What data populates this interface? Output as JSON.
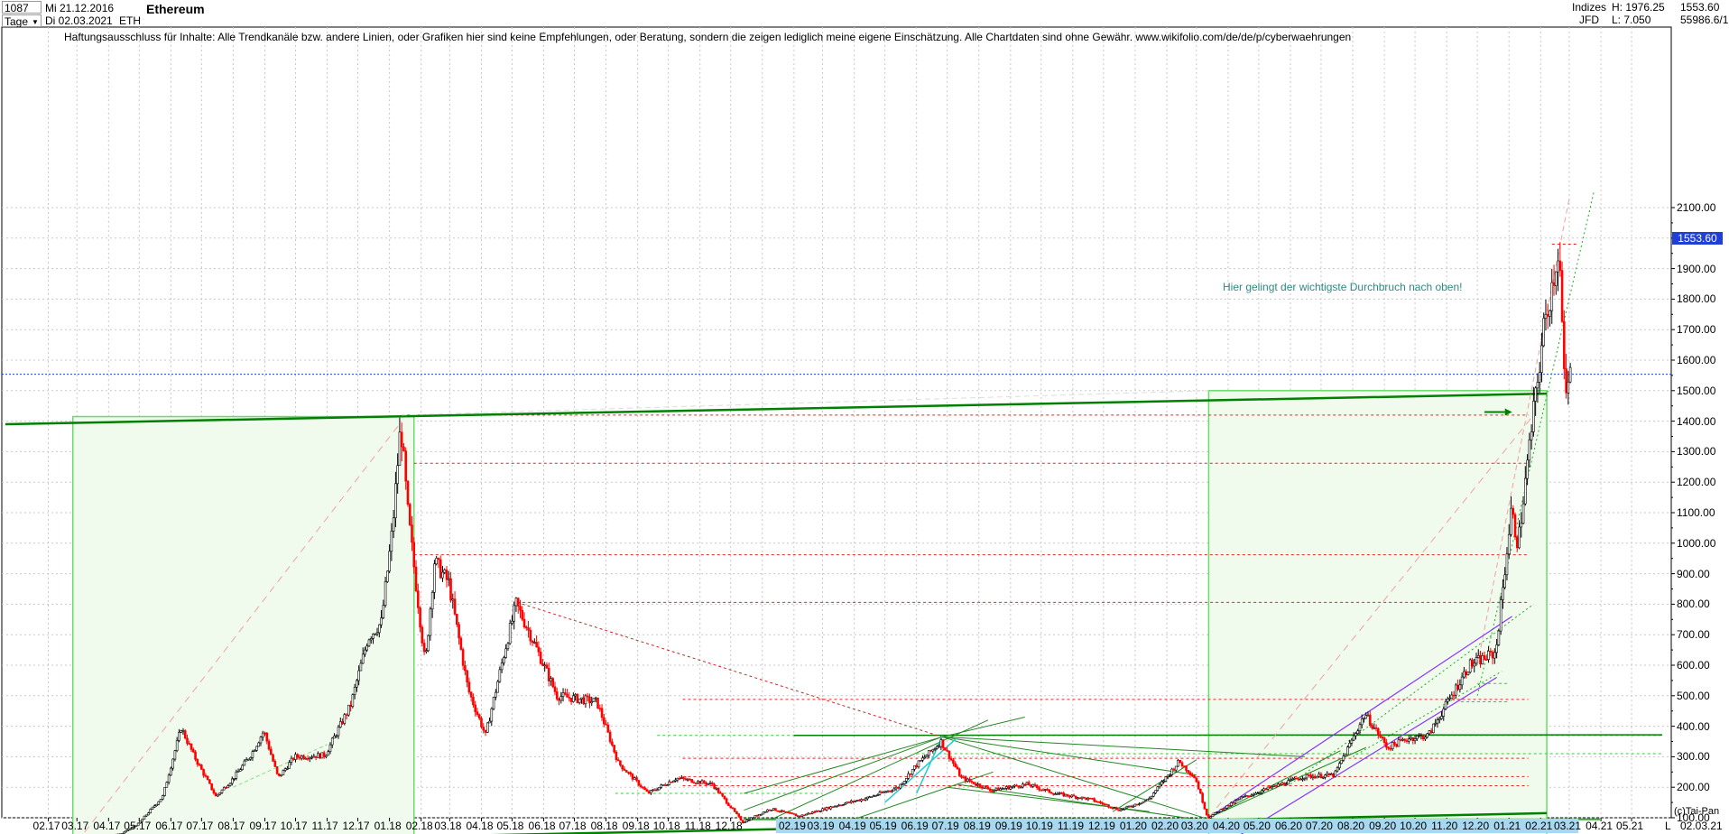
{
  "header": {
    "period_count": "1087",
    "interval": "Tage",
    "date_start": "Mi 21.12.2016",
    "date_end": "Di 02.03.2021",
    "symbol_short": "ETH",
    "title": "Ethereum",
    "market_1": "Indizes",
    "market_2": "JFD",
    "high": "H: 1976.25",
    "low": "L: 7.050",
    "last": "1553.60",
    "volume": "55986.6/1"
  },
  "disclaimer": "Haftungsausschluss für Inhalte: Alle Trendkanäle bzw. andere Linien, oder Grafiken hier sind keine Empfehlungen, oder Beratung, sondern die zeigen lediglich meine eigene Einschätzung. Alle Chartdaten sind ohne Gewähr.  www.wikifolio.com/de/de/p/cyberwaehrungen",
  "annotation": "Hier gelingt der wichtigste Durchbruch nach oben!",
  "current_price_label": "1553.60",
  "copyright": "(c)Tai-Pan",
  "x_axis_end_marker": "L",
  "x_axis_last_label": "02.03.21",
  "colors": {
    "candle_up": "#000000",
    "candle_down": "#ff0000",
    "trend_channel": "#008000",
    "zone_fill": "#f0fbee",
    "zone_border": "#66dd66",
    "support_line": "#ee2222",
    "current_price_line": "#1f3fd8",
    "uptrend_channel": "#8833ff"
  },
  "chart_data": {
    "type": "candlestick",
    "title": "Ethereum",
    "ylim": [
      0,
      2100
    ],
    "y_ticks": [
      "100.00",
      "200.00",
      "300.00",
      "400.00",
      "500.00",
      "600.00",
      "700.00",
      "800.00",
      "900.00",
      "1000.00",
      "1100.00",
      "1200.00",
      "1300.00",
      "1400.00",
      "1500.00",
      "1600.00",
      "1700.00",
      "1800.00",
      "1900.00",
      "2000.00",
      "2100.00"
    ],
    "x_tick_labels": [
      "02.17",
      "03.17",
      "04.17",
      "05.17",
      "06.17",
      "07.17",
      "08.17",
      "09.17",
      "10.17",
      "11.17",
      "12.17",
      "01.18",
      "02.18",
      "03.18",
      "04.18",
      "05.18",
      "06.18",
      "07.18",
      "08.18",
      "09.18",
      "10.18",
      "11.18",
      "12.18",
      "02.19",
      "03.19",
      "04.19",
      "05.19",
      "06.19",
      "07.19",
      "08.19",
      "09.19",
      "10.19",
      "11.19",
      "12.19",
      "01.20",
      "02.20",
      "03.20",
      "04.20",
      "05.20",
      "06.20",
      "07.20",
      "08.20",
      "09.20",
      "10.20",
      "11.20",
      "12.20",
      "01.21",
      "02.21",
      "03.21",
      "04.21",
      "05.21"
    ],
    "x_range": [
      "2016-12-21",
      "2021-05-31"
    ],
    "price_path": [
      [
        "2016-12-21",
        8
      ],
      [
        "2017-02-01",
        11
      ],
      [
        "2017-03-01",
        16
      ],
      [
        "2017-03-15",
        35
      ],
      [
        "2017-04-15",
        48
      ],
      [
        "2017-05-01",
        80
      ],
      [
        "2017-05-25",
        170
      ],
      [
        "2017-06-12",
        395
      ],
      [
        "2017-06-25",
        300
      ],
      [
        "2017-07-16",
        170
      ],
      [
        "2017-08-01",
        225
      ],
      [
        "2017-08-20",
        310
      ],
      [
        "2017-09-01",
        385
      ],
      [
        "2017-09-15",
        230
      ],
      [
        "2017-10-01",
        300
      ],
      [
        "2017-10-31",
        305
      ],
      [
        "2017-11-25",
        470
      ],
      [
        "2017-12-12",
        690
      ],
      [
        "2017-12-25",
        740
      ],
      [
        "2018-01-05",
        1050
      ],
      [
        "2018-01-13",
        1390
      ],
      [
        "2018-01-20",
        1100
      ],
      [
        "2018-02-06",
        600
      ],
      [
        "2018-02-15",
        940
      ],
      [
        "2018-03-01",
        870
      ],
      [
        "2018-03-20",
        520
      ],
      [
        "2018-04-06",
        370
      ],
      [
        "2018-04-25",
        650
      ],
      [
        "2018-05-06",
        800
      ],
      [
        "2018-05-20",
        700
      ],
      [
        "2018-06-15",
        500
      ],
      [
        "2018-07-24",
        480
      ],
      [
        "2018-08-14",
        280
      ],
      [
        "2018-09-12",
        180
      ],
      [
        "2018-10-10",
        230
      ],
      [
        "2018-11-14",
        210
      ],
      [
        "2018-12-14",
        85
      ],
      [
        "2019-01-10",
        130
      ],
      [
        "2019-02-07",
        105
      ],
      [
        "2019-03-15",
        140
      ],
      [
        "2019-04-15",
        165
      ],
      [
        "2019-05-15",
        200
      ],
      [
        "2019-06-01",
        270
      ],
      [
        "2019-06-26",
        350
      ],
      [
        "2019-07-16",
        230
      ],
      [
        "2019-08-15",
        190
      ],
      [
        "2019-09-18",
        210
      ],
      [
        "2019-10-15",
        180
      ],
      [
        "2019-11-20",
        160
      ],
      [
        "2019-12-18",
        125
      ],
      [
        "2020-01-15",
        160
      ],
      [
        "2020-02-14",
        285
      ],
      [
        "2020-03-01",
        230
      ],
      [
        "2020-03-13",
        100
      ],
      [
        "2020-04-15",
        165
      ],
      [
        "2020-05-15",
        200
      ],
      [
        "2020-06-15",
        235
      ],
      [
        "2020-07-15",
        240
      ],
      [
        "2020-08-14",
        440
      ],
      [
        "2020-09-05",
        330
      ],
      [
        "2020-09-25",
        360
      ],
      [
        "2020-10-15",
        370
      ],
      [
        "2020-11-24",
        600
      ],
      [
        "2020-12-20",
        640
      ],
      [
        "2021-01-04",
        1100
      ],
      [
        "2021-01-11",
        1000
      ],
      [
        "2021-01-25",
        1400
      ],
      [
        "2021-02-05",
        1700
      ],
      [
        "2021-02-20",
        1976
      ],
      [
        "2021-02-26",
        1450
      ],
      [
        "2021-03-02",
        1553.6
      ]
    ],
    "high": 1976.25,
    "low": 7.05,
    "last": 1553.6,
    "horizontal_levels": [
      1420,
      1262,
      962,
      806,
      488,
      295,
      235,
      205
    ],
    "annotations": [
      "Hier gelingt der wichtigste Durchbruch nach oben!"
    ],
    "grid": true
  }
}
